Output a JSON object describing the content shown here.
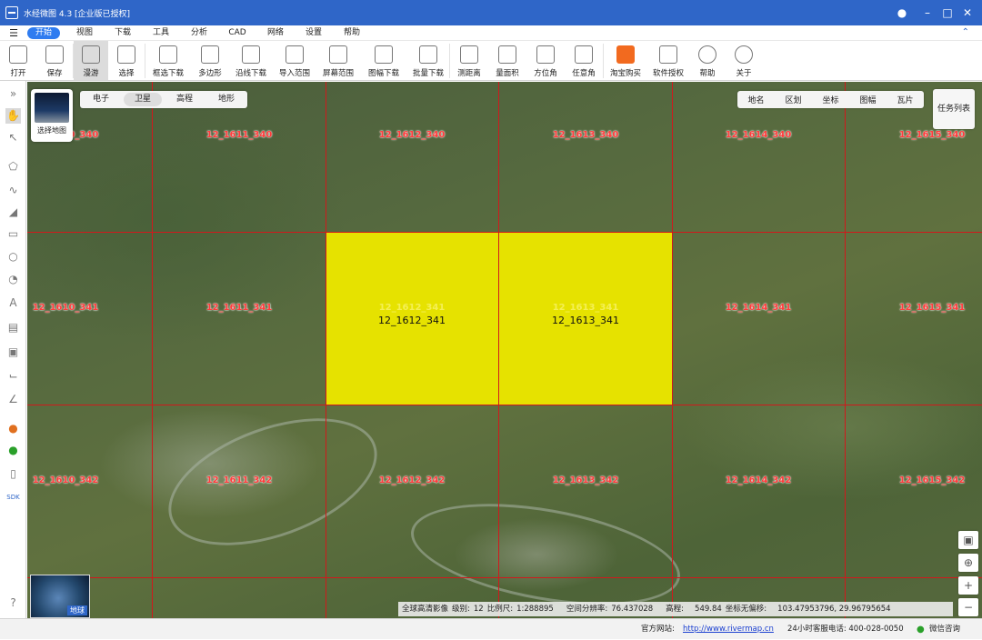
{
  "window": {
    "title": "水经微图 4.3 [企业版已授权]"
  },
  "menu": {
    "items": [
      "开始",
      "视图",
      "下载",
      "工具",
      "分析",
      "CAD",
      "网络",
      "设置",
      "帮助"
    ]
  },
  "toolbar": {
    "items": [
      {
        "label": "打开",
        "icon": "folder-icon"
      },
      {
        "label": "保存",
        "icon": "save-icon"
      },
      {
        "label": "漫游",
        "icon": "hand-icon"
      },
      {
        "label": "选择",
        "icon": "cursor-icon"
      },
      {
        "label": "框选下载",
        "icon": "box-download-icon"
      },
      {
        "label": "多边形",
        "icon": "polygon-icon"
      },
      {
        "label": "沿线下载",
        "icon": "line-download-icon"
      },
      {
        "label": "导入范围",
        "icon": "import-icon"
      },
      {
        "label": "屏幕范围",
        "icon": "screen-icon"
      },
      {
        "label": "图幅下载",
        "icon": "sheet-icon"
      },
      {
        "label": "批量下载",
        "icon": "batch-icon"
      },
      {
        "label": "测距离",
        "icon": "ruler-icon"
      },
      {
        "label": "量面积",
        "icon": "area-icon"
      },
      {
        "label": "方位角",
        "icon": "bearing-icon"
      },
      {
        "label": "任意角",
        "icon": "angle-icon"
      },
      {
        "label": "淘宝购买",
        "icon": "taobao-icon"
      },
      {
        "label": "软件授权",
        "icon": "lock-icon"
      },
      {
        "label": "帮助",
        "icon": "help-icon"
      },
      {
        "label": "关于",
        "icon": "info-icon"
      }
    ]
  },
  "map": {
    "basemap_label": "选择地图",
    "layer_tabs": [
      "电子",
      "卫星",
      "高程",
      "地形"
    ],
    "overlay_tabs": [
      "地名",
      "区划",
      "坐标",
      "图幅",
      "瓦片"
    ],
    "task_list": "任务列表",
    "globe_label": "地球",
    "tiles": [
      "12_1610_340",
      "12_1611_340",
      "12_1612_340",
      "12_1613_340",
      "12_1614_340",
      "12_1615_340",
      "12_1610_341",
      "12_1611_341",
      "12_1612_341",
      "12_1613_341",
      "12_1614_341",
      "12_1615_341",
      "12_1610_342",
      "12_1611_342",
      "12_1612_342",
      "12_1613_342",
      "12_1614_342",
      "12_1615_342"
    ]
  },
  "status": {
    "source": "全球高清影像",
    "level_label": "级别:",
    "level": "12",
    "scale_label": "比例尺:",
    "scale": "1:288895",
    "resolution_label": "空间分辨率:",
    "resolution": "76.437028",
    "elevation_label": "高程:",
    "elevation": "549.84",
    "coord_label": "坐标无偏移:",
    "coords": "103.47953796, 29.96795654"
  },
  "footer": {
    "site_label": "官方网站:",
    "site_url": "http://www.rivermap.cn",
    "hotline": "24小时客服电话: 400-028-0050",
    "wechat": "微信咨询"
  },
  "colors": {
    "title_bar": "#2f66c8",
    "grid_line": "#d0191c",
    "selected_tile": "#e6e200",
    "tile_label": "#ff3b3b"
  }
}
